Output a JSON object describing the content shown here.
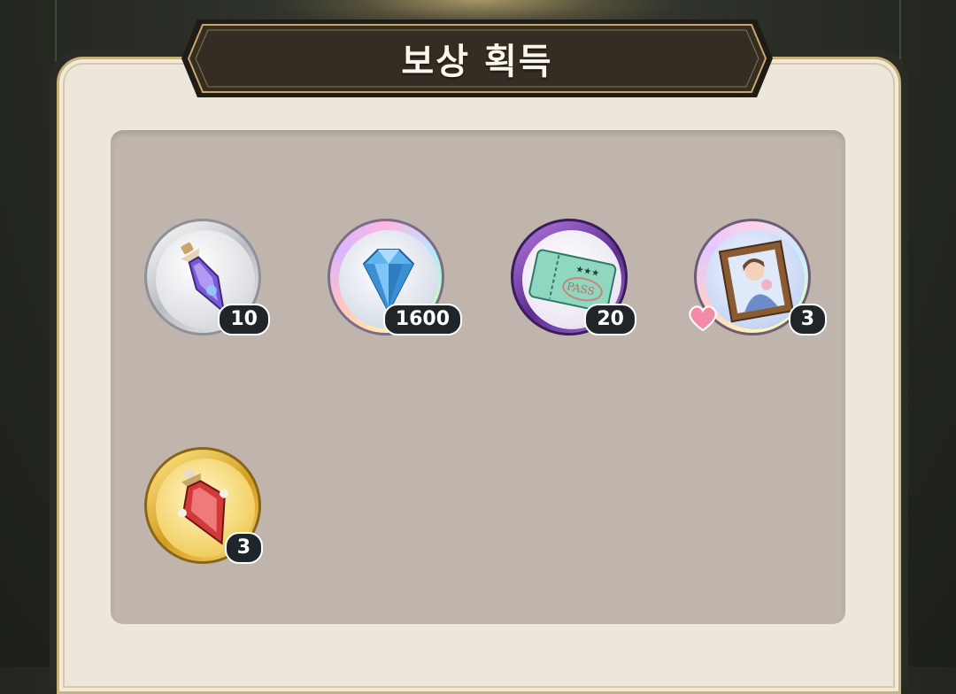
{
  "dialog": {
    "title": "보상 획득"
  },
  "rewards": [
    {
      "item": "purple-potion",
      "count": "10",
      "frame": "silver"
    },
    {
      "item": "blue-diamond",
      "count": "1600",
      "frame": "rainbow"
    },
    {
      "item": "pass-ticket",
      "count": "20",
      "frame": "purple"
    },
    {
      "item": "character-portrait",
      "count": "3",
      "frame": "rainbow",
      "badge": "heart-icon"
    },
    {
      "item": "red-potion",
      "count": "3",
      "frame": "gold"
    }
  ],
  "colors": {
    "panel_bg": "#ece6db",
    "grid_bg": "#bfb5ad",
    "title_bar": "#2f2a22",
    "title_border": "#c9a869",
    "badge_bg": "#1f2529"
  }
}
